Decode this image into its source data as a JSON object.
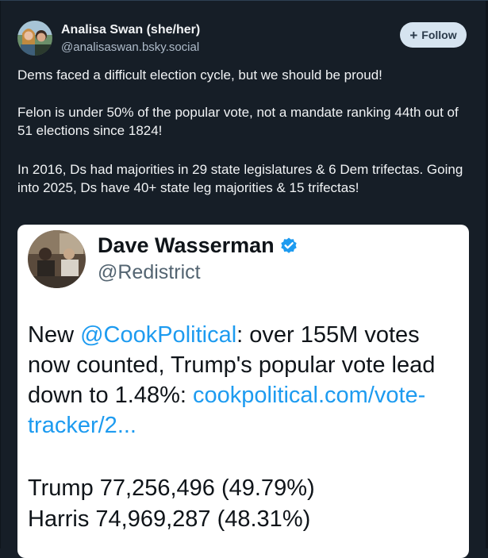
{
  "author": {
    "display_name": "Analisa Swan (she/her)",
    "handle": "@analisaswan.bsky.social"
  },
  "follow_button": {
    "icon": "plus-icon",
    "label": "Follow"
  },
  "post": {
    "paragraph_1": "Dems faced a difficult election cycle, but we should be proud!",
    "paragraph_2": "Felon is under 50% of the popular vote, not a mandate ranking 44th out of 51 elections since 1824!",
    "paragraph_3": "In 2016, Ds had majorities in 29 state legislatures & 6 Dem trifectas. Going into 2025, Ds have 40+ state leg majorities & 15 trifectas!"
  },
  "embedded_tweet": {
    "display_name": "Dave Wasserman",
    "verified_icon": "verified-badge-icon",
    "handle": "@Redistrict",
    "body_prefix": "New ",
    "mention": "@CookPolitical",
    "body_middle": ": over 155M votes now counted, Trump's popular vote lead down to 1.48%: ",
    "link_text": "cookpolitical.com/vote-tracker/2...",
    "result_trump": "Trump 77,256,496 (49.79%)",
    "result_harris": "Harris 74,969,287 (48.31%)"
  },
  "colors": {
    "background": "#161e27",
    "text_primary": "#f1f3f5",
    "text_secondary": "#aebbc9",
    "follow_bg": "#d6e4f0",
    "link_blue": "#1d9bf0",
    "verified_blue": "#1d9bf0"
  }
}
